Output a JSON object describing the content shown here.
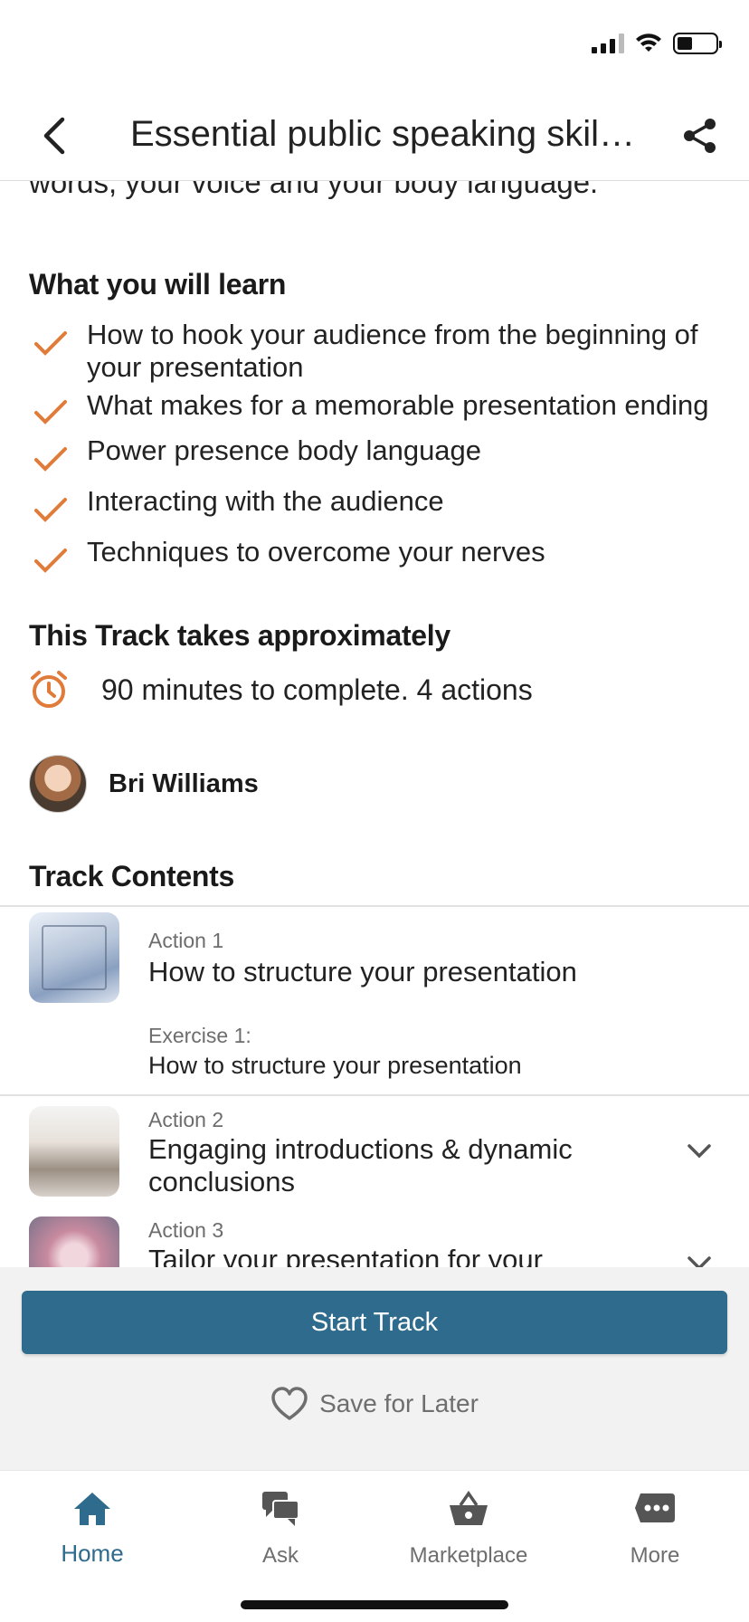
{
  "header": {
    "title": "Essential public speaking skills…"
  },
  "intro": {
    "text_tail": "words, your voice and your body language."
  },
  "learn": {
    "heading": "What you will learn",
    "items": [
      "How to hook your audience from the beginning of your presentation",
      "What makes for a memorable presentation ending",
      "Power presence body language",
      "Interacting with the audience",
      "Techniques to overcome your nerves"
    ]
  },
  "duration": {
    "heading": "This Track takes approximately",
    "text": "90 minutes to complete. 4 actions"
  },
  "author": {
    "name": "Bri Williams"
  },
  "contents": {
    "heading": "Track Contents",
    "actions": [
      {
        "label": "Action 1",
        "title": "How to structure your presentation",
        "exercise_label": "Exercise 1:",
        "exercise_title": "How to structure your presentation"
      },
      {
        "label": "Action 2",
        "title": "Engaging introductions & dynamic conclusions"
      },
      {
        "label": "Action 3",
        "title": "Tailor your presentation for your"
      }
    ]
  },
  "buttons": {
    "start": "Start Track",
    "save": "Save for Later"
  },
  "tabs": [
    {
      "label": "Home",
      "icon": "home-icon",
      "active": true
    },
    {
      "label": "Ask",
      "icon": "chat-bubbles-icon",
      "active": false
    },
    {
      "label": "Marketplace",
      "icon": "basket-icon",
      "active": false
    },
    {
      "label": "More",
      "icon": "more-dots-icon",
      "active": false
    }
  ],
  "colors": {
    "accent": "#2e6b8c",
    "check": "#e07b3a",
    "panel_bg": "#f2f2f2"
  }
}
